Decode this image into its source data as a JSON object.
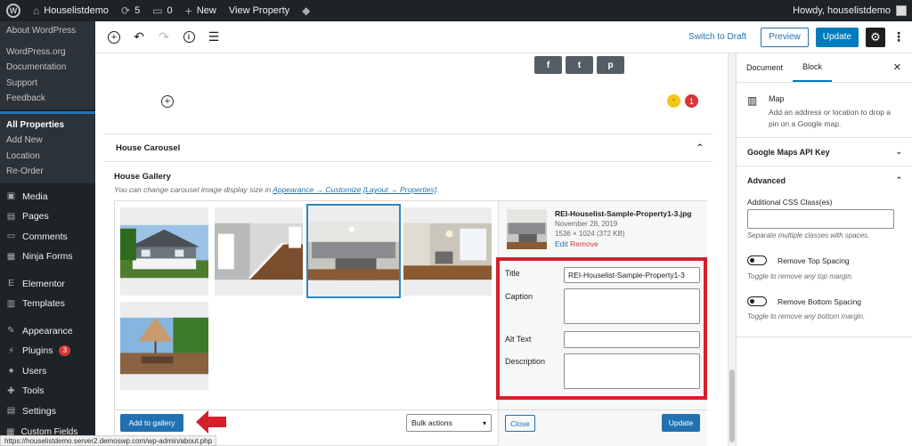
{
  "adminbar": {
    "site_name": "Houselistdemo",
    "updates_count": "5",
    "comments_count": "0",
    "new_label": "New",
    "view_property_label": "View Property",
    "howdy": "Howdy, houselistdemo"
  },
  "sidebar": {
    "wp_links": [
      "About WordPress",
      "WordPress.org",
      "Documentation",
      "Support",
      "Feedback"
    ],
    "properties": [
      "All Properties",
      "Add New",
      "Location",
      "Re-Order"
    ],
    "menu": [
      {
        "label": "Media",
        "icon": "media-icon"
      },
      {
        "label": "Pages",
        "icon": "pages-icon"
      },
      {
        "label": "Comments",
        "icon": "comments-icon"
      },
      {
        "label": "Ninja Forms",
        "icon": "ninja-forms-icon"
      },
      {
        "label": "Elementor",
        "icon": "elementor-icon"
      },
      {
        "label": "Templates",
        "icon": "templates-icon"
      },
      {
        "label": "Appearance",
        "icon": "appearance-icon"
      },
      {
        "label": "Plugins",
        "icon": "plugins-icon",
        "badge": "3"
      },
      {
        "label": "Users",
        "icon": "users-icon"
      },
      {
        "label": "Tools",
        "icon": "tools-icon"
      },
      {
        "label": "Settings",
        "icon": "settings-icon"
      }
    ],
    "custom_fields": "Custom Fields"
  },
  "toolbar": {
    "switch_draft": "Switch to Draft",
    "preview": "Preview",
    "update": "Update"
  },
  "content": {
    "share": [
      "f",
      "t",
      "p"
    ],
    "error_count": "1",
    "metabox_title": "House Carousel",
    "gallery_label": "House Gallery",
    "gallery_desc_prefix": "You can change carousel image display size in ",
    "gallery_desc_link1": "Appearance → Customize",
    "gallery_desc_sep": " ",
    "gallery_desc_link2": "[Layout → Properties]",
    "gallery_desc_suffix": ".",
    "attachment": {
      "filename": "REI-Houselist-Sample-Property1-3.jpg",
      "date": "November 28, 2019",
      "dimensions": "1536 × 1024 (372 KB)",
      "edit": "Edit",
      "remove": "Remove"
    },
    "fields": {
      "title_label": "Title",
      "title_value": "REI-Houselist-Sample-Property1-3",
      "caption_label": "Caption",
      "alt_label": "Alt Text",
      "description_label": "Description"
    },
    "add_gallery": "Add to gallery",
    "bulk_actions": "Bulk actions",
    "close": "Close",
    "update": "Update"
  },
  "panel": {
    "tab_document": "Document",
    "tab_block": "Block",
    "block_name": "Map",
    "block_desc": "Add an address or location to drop a pin on a Google map.",
    "section_api": "Google Maps API Key",
    "section_advanced": "Advanced",
    "css_label": "Additional CSS Class(es)",
    "css_help": "Separate multiple classes with spaces.",
    "toggle_top": "Remove Top Spacing",
    "toggle_top_help": "Toggle to remove any top margin.",
    "toggle_bottom": "Remove Bottom Spacing",
    "toggle_bottom_help": "Toggle to remove any bottom margin."
  },
  "statusbar": "https://houselistdemo.server2.demoswp.com/wp-admin/about.php",
  "colors": {
    "admin_dark": "#1d2327",
    "primary": "#007cba",
    "highlight": "#d51f2b",
    "selected": "#2e88c4"
  }
}
